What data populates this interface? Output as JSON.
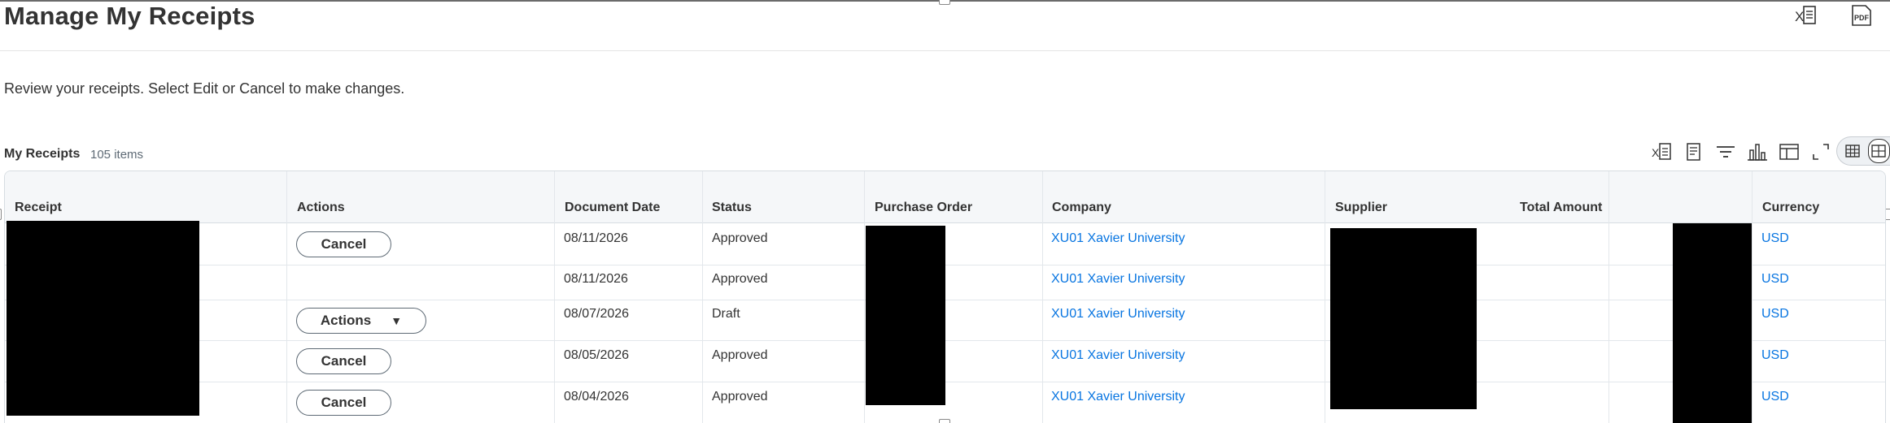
{
  "page": {
    "title": "Manage My Receipts",
    "instructions": "Review your receipts. Select Edit or Cancel to make changes."
  },
  "export": {
    "excel_icon": "excel-export-icon",
    "pdf_icon": "pdf-export-icon"
  },
  "grid": {
    "title": "My Receipts",
    "count": "105 items",
    "toolbar_icons": [
      "excel-export-icon",
      "print-icon",
      "filter-icon",
      "chart-icon",
      "column-layout-icon",
      "fullscreen-icon"
    ],
    "view_icons": [
      "table-view-icon",
      "grid-view-icon"
    ],
    "columns": {
      "receipt": "Receipt",
      "actions": "Actions",
      "document_date": "Document Date",
      "status": "Status",
      "purchase_order": "Purchase Order",
      "company": "Company",
      "supplier": "Supplier",
      "total_amount": "Total Amount",
      "currency": "Currency"
    },
    "rows": [
      {
        "action": "Cancel",
        "document_date": "08/11/2026",
        "status": "Approved",
        "company": "XU01 Xavier University",
        "currency": "USD"
      },
      {
        "action": "",
        "document_date": "08/11/2026",
        "status": "Approved",
        "company": "XU01 Xavier University",
        "currency": "USD"
      },
      {
        "action": "Actions",
        "document_date": "08/07/2026",
        "status": "Draft",
        "company": "XU01 Xavier University",
        "currency": "USD"
      },
      {
        "action": "Cancel",
        "document_date": "08/05/2026",
        "status": "Approved",
        "company": "XU01 Xavier University",
        "currency": "USD"
      },
      {
        "action": "Cancel",
        "document_date": "08/04/2026",
        "status": "Approved",
        "company": "XU01 Xavier University",
        "currency": "USD"
      }
    ]
  },
  "colors": {
    "link": "#0875e1",
    "text": "#333333",
    "header_bg": "#f5f7f9",
    "border": "#d7dde2"
  }
}
